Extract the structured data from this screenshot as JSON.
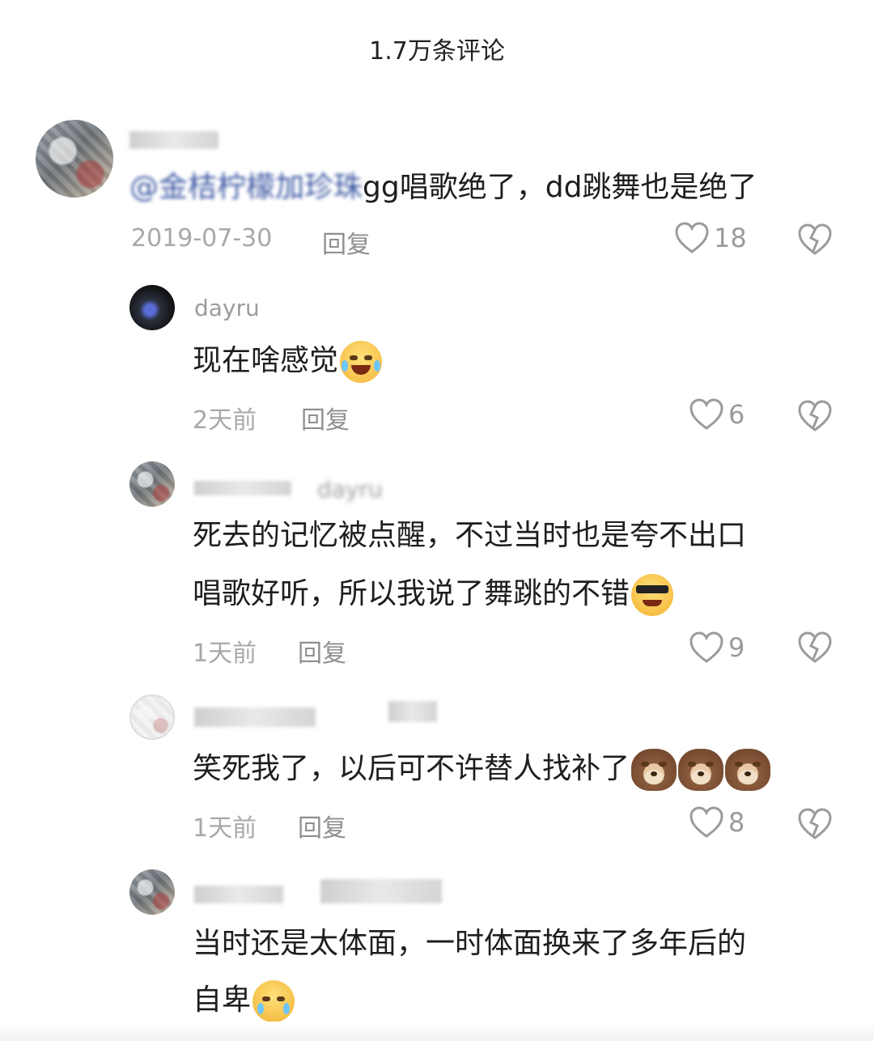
{
  "header": {
    "title": "1.7万条评论"
  },
  "comments": [
    {
      "username": "",
      "mention": "@金桔柠檬加珍珠",
      "text": "gg唱歌绝了，dd跳舞也是绝了",
      "date": "2019-07-30",
      "reply_label": "回复",
      "likes": "18"
    },
    {
      "username": "dayru",
      "text": "现在啥感觉",
      "emoji": "cry-laugh-icon",
      "date": "2天前",
      "reply_label": "回复",
      "likes": "6"
    },
    {
      "username": "",
      "reply_to": "dayru",
      "lines": [
        "死去的记忆被点醒，不过当时也是夸不出口",
        "唱歌好听，所以我说了舞跳的不错"
      ],
      "emoji": "sunglasses-icon",
      "date": "1天前",
      "reply_label": "回复",
      "likes": "9"
    },
    {
      "username": "",
      "text": "笑死我了，以后可不许替人找补了",
      "emoji": "bear-icon",
      "date": "1天前",
      "reply_label": "回复",
      "likes": "8"
    },
    {
      "username": "",
      "lines": [
        "当时还是太体面，一时体面换来了多年后的",
        "自卑"
      ],
      "emoji": "sad-tear-icon"
    }
  ],
  "colors": {
    "text": "#1e1e1e",
    "meta": "#a8a8a8",
    "mention": "#3b57a3",
    "icon": "#9b9b9b"
  }
}
